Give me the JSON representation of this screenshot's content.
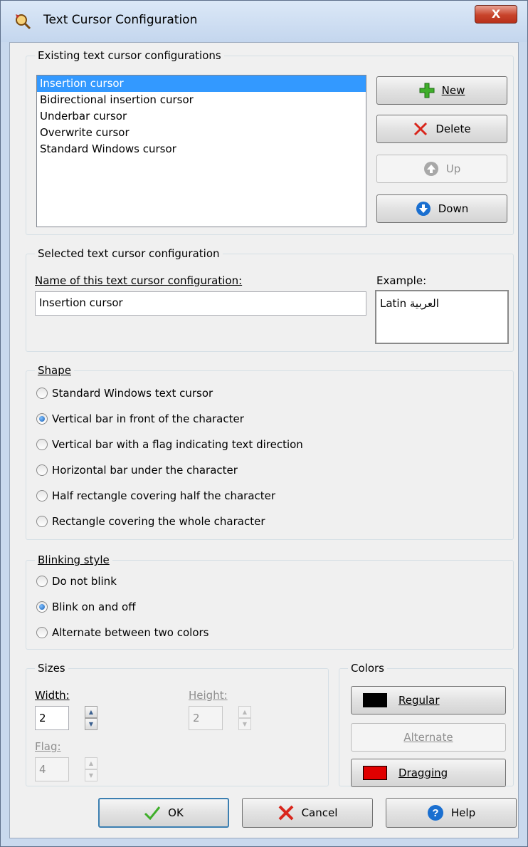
{
  "window": {
    "title": "Text Cursor Configuration",
    "close_label": "X"
  },
  "existing": {
    "group_label": "Existing text cursor configurations",
    "items": [
      "Insertion cursor",
      "Bidirectional insertion cursor",
      "Underbar cursor",
      "Overwrite cursor",
      "Standard Windows cursor"
    ],
    "selected_index": 0,
    "buttons": {
      "new_label": "New",
      "delete_label": "Delete",
      "up_label": "Up",
      "down_label": "Down"
    }
  },
  "selected": {
    "group_label": "Selected text cursor configuration",
    "name_label": "Name of this text cursor configuration:",
    "name_value": "Insertion cursor",
    "example_label": "Example:",
    "example_text": "Latin العربية"
  },
  "shape": {
    "group_label": "Shape",
    "options": [
      "Standard Windows text cursor",
      "Vertical bar in front of the character",
      "Vertical bar with a flag indicating text direction",
      "Horizontal bar under the character",
      "Half rectangle covering half the character",
      "Rectangle covering the whole character"
    ],
    "selected_index": 1
  },
  "blinking": {
    "group_label": "Blinking style",
    "options": [
      "Do not blink",
      "Blink on and off",
      "Alternate between two colors"
    ],
    "selected_index": 1
  },
  "sizes": {
    "group_label": "Sizes",
    "width_label": "Width:",
    "width_value": "2",
    "height_label": "Height:",
    "height_value": "2",
    "flag_label": "Flag:",
    "flag_value": "4"
  },
  "colors": {
    "group_label": "Colors",
    "regular_label": "Regular",
    "alternate_label": "Alternate",
    "dragging_label": "Dragging",
    "regular_color": "#000000",
    "dragging_color": "#e00000"
  },
  "footer": {
    "ok_label": "OK",
    "cancel_label": "Cancel",
    "help_label": "Help"
  }
}
